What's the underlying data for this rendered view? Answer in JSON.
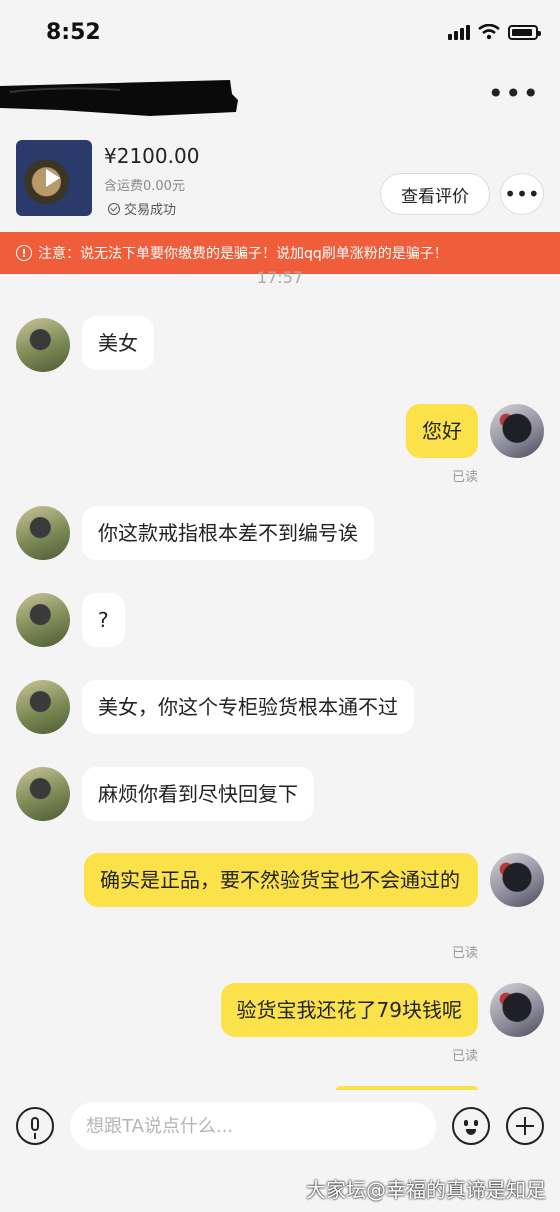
{
  "status_bar": {
    "time": "8:52"
  },
  "product": {
    "price": "¥2100.00",
    "shipping": "含运费0.00元",
    "deal_status": "交易成功",
    "review_button": "查看评价"
  },
  "warning": {
    "text": "注意：说无法下单要你缴费的是骗子！说加qq刷单涨粉的是骗子！"
  },
  "chat": {
    "timestamp": "17:57",
    "messages": [
      {
        "from": "peer",
        "text": "美女"
      },
      {
        "from": "me",
        "text": "您好",
        "read": "已读"
      },
      {
        "from": "peer",
        "text": "你这款戒指根本差不到编号诶"
      },
      {
        "from": "peer",
        "text": "?"
      },
      {
        "from": "peer",
        "text": "美女，你这个专柜验货根本通不过"
      },
      {
        "from": "peer",
        "text": "麻烦你看到尽快回复下"
      },
      {
        "from": "me",
        "text": "确实是正品，要不然验货宝也不会通过的",
        "read": "已读"
      },
      {
        "from": "me",
        "text": "验货宝我还花了79块钱呢",
        "read": "已读"
      }
    ]
  },
  "input": {
    "placeholder": "想跟TA说点什么..."
  },
  "watermark": "大家坛@幸福的真谛是知足",
  "icons": {
    "play": "play-icon",
    "check": "check-circle-icon",
    "warning": "warning-icon",
    "mic": "microphone-icon",
    "emoji": "emoji-icon",
    "plus": "plus-icon"
  },
  "colors": {
    "warning_bg": "#ef5d3a",
    "my_bubble": "#fbe24a",
    "peer_bubble": "#ffffff"
  }
}
